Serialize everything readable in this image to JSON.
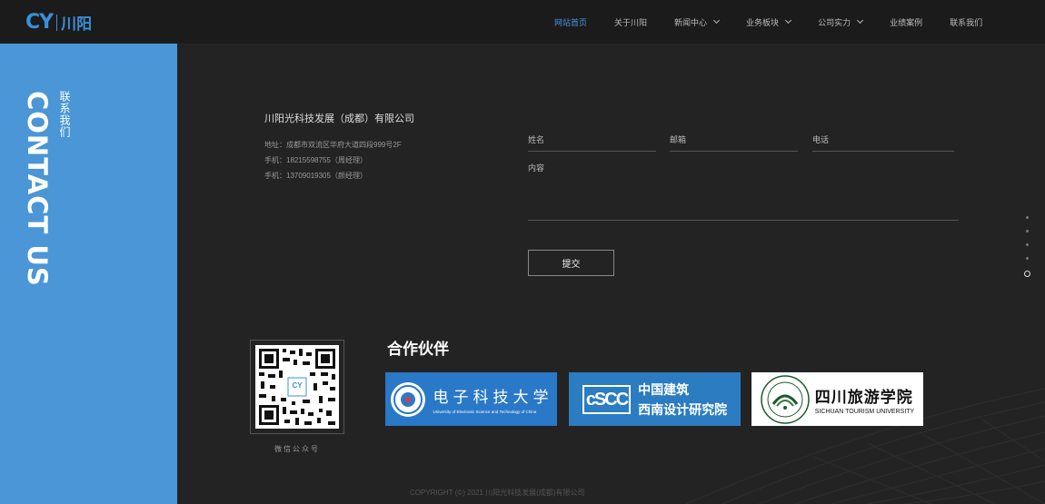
{
  "logo": {
    "mark": "CY",
    "text": "川阳"
  },
  "nav": [
    {
      "label": "网站首页",
      "active": true,
      "dropdown": false
    },
    {
      "label": "关于川阳",
      "active": false,
      "dropdown": false
    },
    {
      "label": "新闻中心",
      "active": false,
      "dropdown": true
    },
    {
      "label": "业务板块",
      "active": false,
      "dropdown": true
    },
    {
      "label": "公司实力",
      "active": false,
      "dropdown": true
    },
    {
      "label": "业绩案例",
      "active": false,
      "dropdown": false
    },
    {
      "label": "联系我们",
      "active": false,
      "dropdown": false
    }
  ],
  "side": {
    "en": "CONTACT US",
    "cn": "联系我们"
  },
  "contact": {
    "company": "川阳光科技发展（成都）有限公司",
    "address": "地址：成都市双流区华府大道四段999号2F",
    "phone1": "手机：18215598755（周经理）",
    "phone2": "手机：13709019305（颜经理）"
  },
  "form": {
    "name": "姓名",
    "email": "邮箱",
    "phone": "电话",
    "content": "内容",
    "submit": "提交"
  },
  "qr": {
    "label": "微信公众号",
    "center": "CY"
  },
  "partners": {
    "title": "合作伙伴",
    "items": [
      {
        "cn": "电子科技大学",
        "en": "University of Electronic Science and Technology of China"
      },
      {
        "cn1": "中国建筑",
        "cn2": "西南设计研究院",
        "mark": "cSCC"
      },
      {
        "cn": "四川旅游学院",
        "en": "SICHUAN TOURISM UNIVERSITY"
      }
    ]
  },
  "copyright": "COPYRIGHT (©) 2021 川阳光科技发展(成都)有限公司",
  "colors": {
    "accent": "#4a96d6",
    "nav_active": "#4a96e0"
  }
}
